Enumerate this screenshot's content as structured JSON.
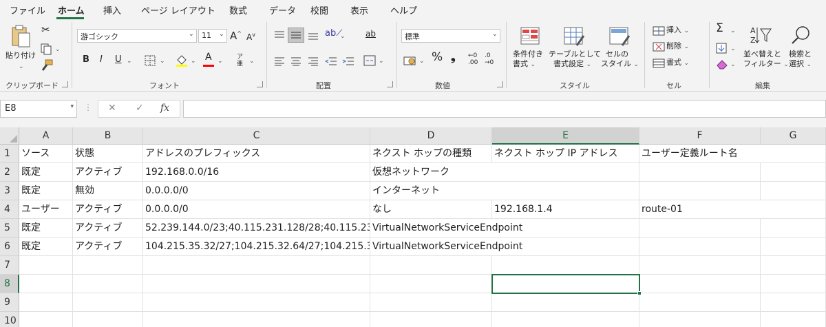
{
  "ribbon_tabs": [
    "ファイル",
    "ホーム",
    "挿入",
    "ページ レイアウト",
    "数式",
    "データ",
    "校閲",
    "表示",
    "ヘルプ"
  ],
  "active_tab": "ホーム",
  "colors": {
    "accent": "#217346",
    "font_color_bar": "#ff0000",
    "fill_color_bar": "#ffff00"
  },
  "clipboard": {
    "paste_label": "貼り付け",
    "group_label": "クリップボード"
  },
  "font": {
    "name": "游ゴシック",
    "size": "11",
    "bold": "B",
    "italic": "I",
    "underline": "U",
    "grow": "A",
    "shrink": "A",
    "phonetic": "亜",
    "group_label": "フォント"
  },
  "alignment": {
    "wrap": "ab",
    "group_label": "配置"
  },
  "number": {
    "format": "標準",
    "percent": "%",
    "comma": "❟",
    "inc_decimal": ".00",
    "dec_decimal": ".0",
    "group_label": "数値"
  },
  "styles": {
    "conditional_l1": "条件付き",
    "conditional_l2": "書式",
    "table_l1": "テーブルとして",
    "table_l2": "書式設定",
    "cell_l1": "セルの",
    "cell_l2": "スタイル",
    "group_label": "スタイル"
  },
  "cells": {
    "insert": "挿入",
    "delete": "削除",
    "format": "書式",
    "group_label": "セル"
  },
  "editing": {
    "sigma": "Σ",
    "sort_l1": "並べ替えと",
    "sort_l2": "フィルター",
    "find_l1": "検索と",
    "find_l2": "選択",
    "group_label": "編集"
  },
  "formula_bar": {
    "name_box": "E8",
    "cancel": "✕",
    "enter": "✓",
    "fx": "fx",
    "content": ""
  },
  "columns": [
    "A",
    "B",
    "C",
    "D",
    "E",
    "F",
    "G"
  ],
  "selected_column": "E",
  "row_numbers": [
    "1",
    "2",
    "3",
    "4",
    "5",
    "6",
    "7",
    "8",
    "9",
    "10"
  ],
  "selected_row": "8",
  "rows": [
    [
      "ソース",
      "状態",
      "アドレスのプレフィックス",
      "ネクスト ホップの種類",
      "ネクスト ホップ IP アドレス",
      "ユーザー定義ルート名",
      ""
    ],
    [
      "既定",
      "アクティブ",
      "192.168.0.0/16",
      "仮想ネットワーク",
      "",
      "",
      ""
    ],
    [
      "既定",
      "無効",
      "0.0.0.0/0",
      "インターネット",
      "",
      "",
      ""
    ],
    [
      "ユーザー",
      "アクティブ",
      "0.0.0.0/0",
      "なし",
      "192.168.1.4",
      "route-01",
      ""
    ],
    [
      "既定",
      "アクティブ",
      "52.239.144.0/23;40.115.231.128/28;40.115.23",
      "VirtualNetworkServiceEndpoint",
      "",
      "",
      ""
    ],
    [
      "既定",
      "アクティブ",
      "104.215.35.32/27;104.215.32.64/27;104.215.3",
      "VirtualNetworkServiceEndpoint",
      "",
      "",
      ""
    ],
    [
      "",
      "",
      "",
      "",
      "",
      "",
      ""
    ],
    [
      "",
      "",
      "",
      "",
      "",
      "",
      ""
    ],
    [
      "",
      "",
      "",
      "",
      "",
      "",
      ""
    ],
    [
      "",
      "",
      "",
      "",
      "",
      "",
      ""
    ]
  ]
}
